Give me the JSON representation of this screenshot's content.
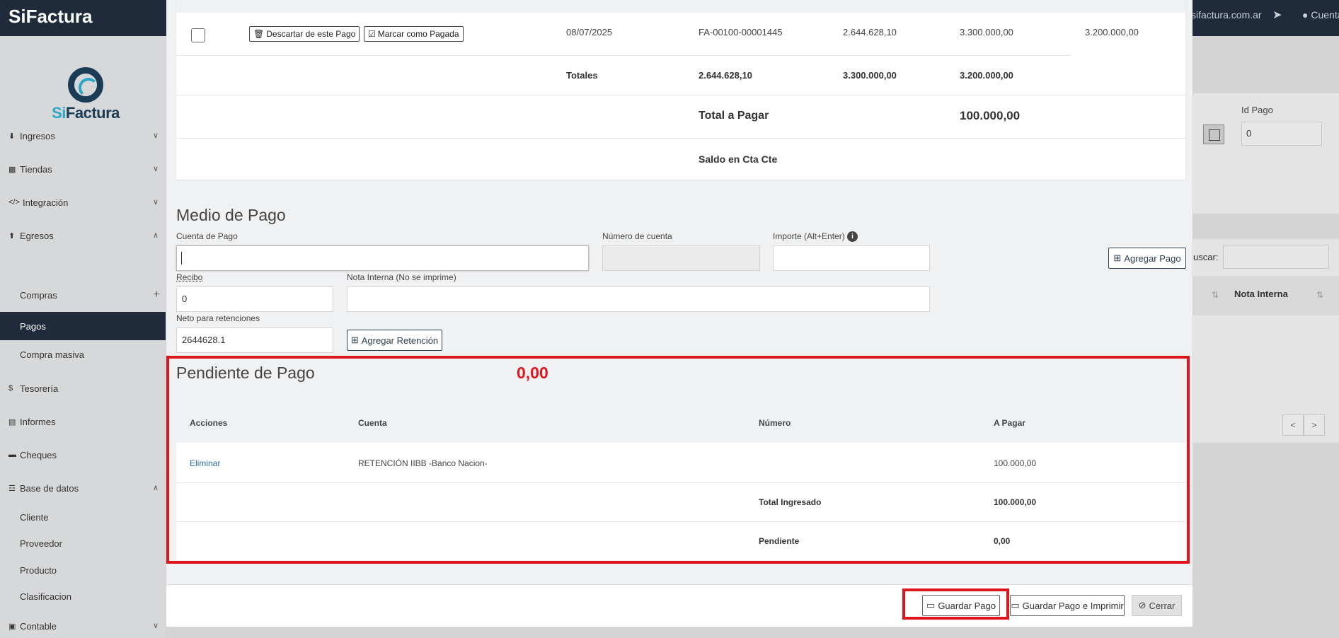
{
  "topbar": {
    "logo": "SiFactura",
    "domain_link": "sifactura.com.ar",
    "plane_icon": "paper-plane-icon",
    "user_label": "Cuenta"
  },
  "sidebar": {
    "brand_si": "Si",
    "brand_factura": "Factura",
    "items": [
      {
        "label": "Ingresos",
        "icon": "download-icon"
      },
      {
        "label": "Tiendas",
        "icon": "briefcase-icon"
      },
      {
        "label": "Integración",
        "icon": "code-icon"
      },
      {
        "label": "Egresos",
        "icon": "upload-icon"
      },
      {
        "label": "Tesorería",
        "icon": "dollar-icon"
      },
      {
        "label": "Informes",
        "icon": "area-chart-icon"
      },
      {
        "label": "Cheques",
        "icon": "credit-card-icon"
      },
      {
        "label": "Base de datos",
        "icon": "database-icon"
      },
      {
        "label": "Contable",
        "icon": "book-icon"
      }
    ],
    "sub_egresos": [
      "Compras",
      "Pagos",
      "Compra masiva"
    ],
    "sub_base": [
      "Cliente",
      "Proveedor",
      "Producto",
      "Clasificacion"
    ]
  },
  "background": {
    "id_pago_label": "Id Pago",
    "id_pago_value": "0",
    "buscar_label": "uscar:",
    "nota_interna_header": "Nota Interna",
    "prev": "<",
    "next": ">"
  },
  "invoice": {
    "descartar_label": "Descartar de este Pago",
    "marcar_label": "Marcar como Pagada",
    "fecha": "08/07/2025",
    "numero": "FA-00100-00001445",
    "neto": "2.644.628,10",
    "total": "3.300.000,00",
    "saldo": "3.200.000,00",
    "totales_label": "Totales",
    "totales_neto": "2.644.628,10",
    "totales_total": "3.300.000,00",
    "totales_saldo": "3.200.000,00",
    "total_a_pagar_label": "Total a Pagar",
    "total_a_pagar_value": "100.000,00",
    "saldo_cta_label": "Saldo en Cta Cte"
  },
  "medio_pago": {
    "title": "Medio de Pago",
    "cuenta_label": "Cuenta de Pago",
    "cuenta_value": "",
    "numero_cuenta_label": "Número de cuenta",
    "importe_label": "Importe (Alt+Enter)",
    "agregar_pago": "Agregar Pago",
    "recibo_label": "Recibo",
    "recibo_value": "0",
    "nota_label": "Nota Interna (No se imprime)",
    "neto_ret_label": "Neto para retenciones",
    "neto_ret_value": "2644628.1",
    "agregar_retencion": "Agregar Retención"
  },
  "pendiente": {
    "title": "Pendiente de Pago",
    "value": "0,00",
    "headers": [
      "Acciones",
      "Cuenta",
      "Número",
      "A Pagar"
    ],
    "row": {
      "accion": "Eliminar",
      "cuenta": "RETENCIÓN IIBB -Banco Nacion-",
      "numero": "",
      "a_pagar": "100.000,00"
    },
    "total_ingresado_label": "Total Ingresado",
    "total_ingresado_value": "100.000,00",
    "pendiente_label": "Pendiente",
    "pendiente_value": "0,00"
  },
  "footer": {
    "guardar": "Guardar Pago",
    "guardar_imprimir": "Guardar Pago e Imprimir",
    "cerrar": "Cerrar"
  },
  "colors": {
    "highlight": "#e0141c",
    "topbar": "#1f2b3a",
    "link": "#2a6fb0"
  }
}
